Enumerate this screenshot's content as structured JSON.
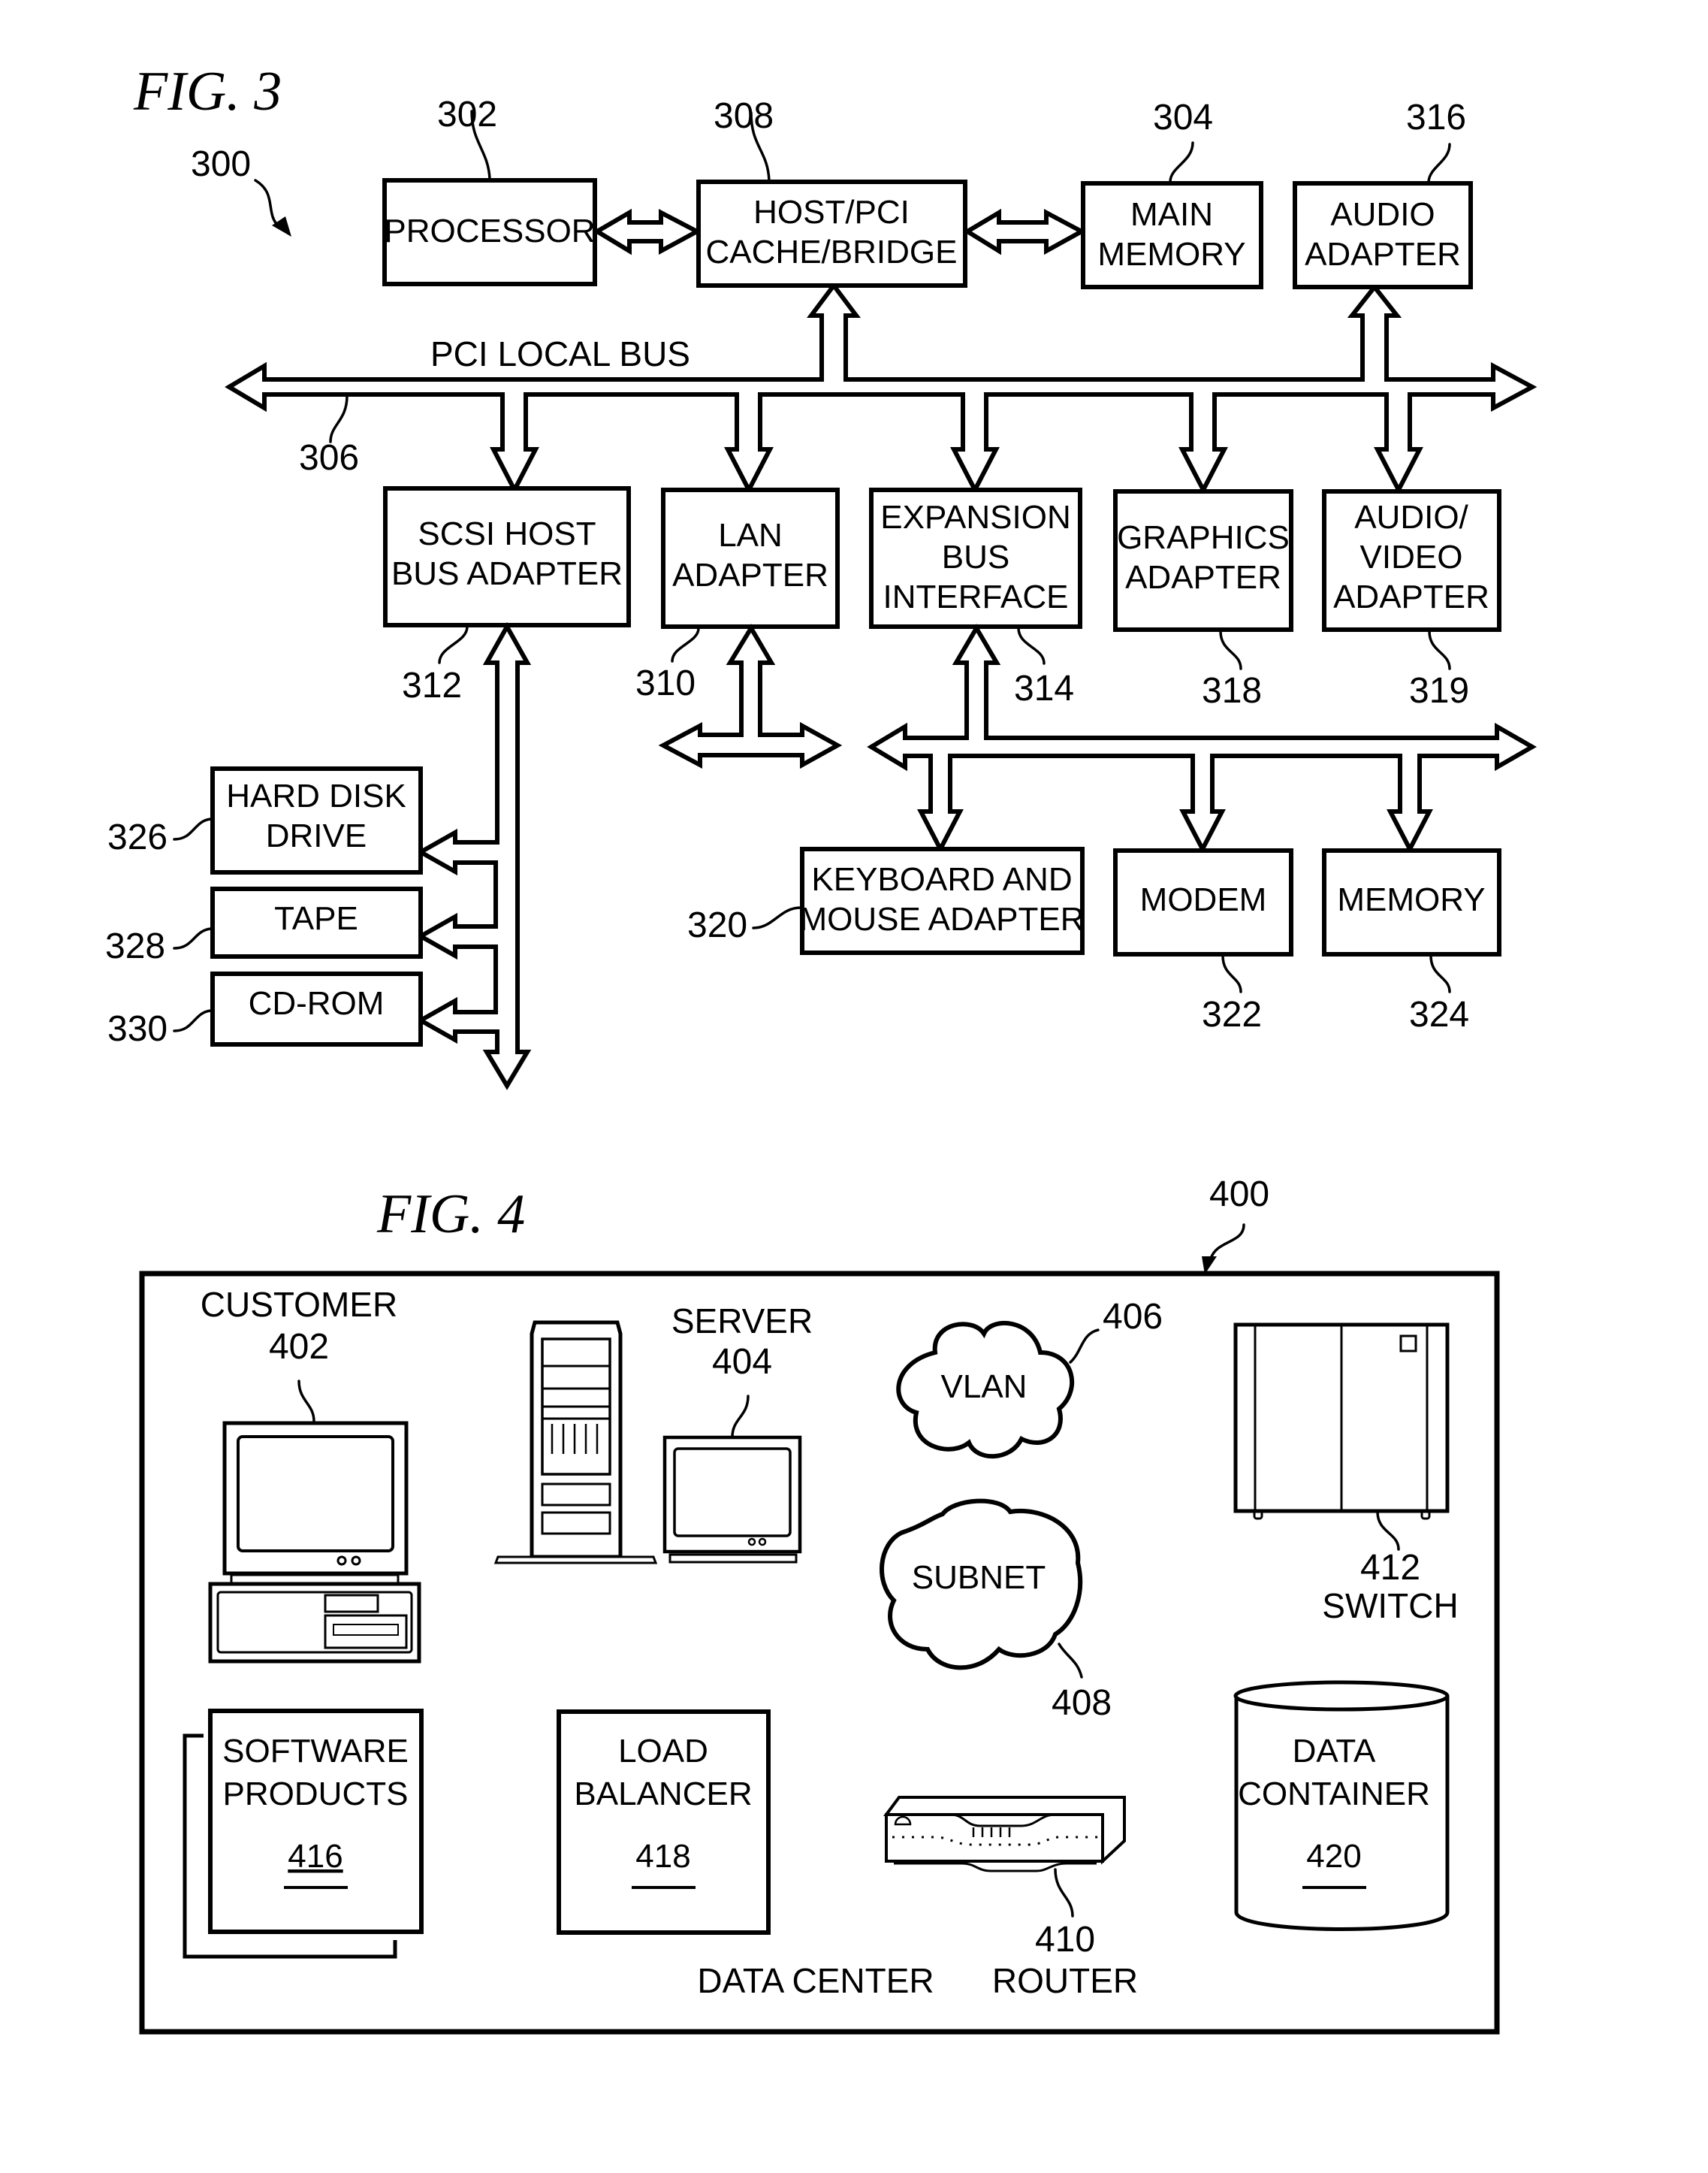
{
  "fig3": {
    "title": "FIG. 3",
    "ref_system": "300",
    "bus_label": "PCI LOCAL BUS",
    "bus_ref": "306",
    "blocks": {
      "processor": {
        "lines": [
          "PROCESSOR"
        ],
        "ref": "302"
      },
      "host_bridge": {
        "lines": [
          "HOST/PCI",
          "CACHE/BRIDGE"
        ],
        "ref": "308"
      },
      "main_memory": {
        "lines": [
          "MAIN",
          "MEMORY"
        ],
        "ref": "304"
      },
      "audio_adapter": {
        "lines": [
          "AUDIO",
          "ADAPTER"
        ],
        "ref": "316"
      },
      "scsi": {
        "lines": [
          "SCSI HOST",
          "BUS ADAPTER"
        ],
        "ref": "312"
      },
      "lan": {
        "lines": [
          "LAN",
          "ADAPTER"
        ],
        "ref": "310"
      },
      "expansion": {
        "lines": [
          "EXPANSION",
          "BUS",
          "INTERFACE"
        ],
        "ref": "314"
      },
      "graphics": {
        "lines": [
          "GRAPHICS",
          "ADAPTER"
        ],
        "ref": "318"
      },
      "av_adapter": {
        "lines": [
          "AUDIO/",
          "VIDEO",
          "ADAPTER"
        ],
        "ref": "319"
      },
      "hdd": {
        "lines": [
          "HARD DISK",
          "DRIVE"
        ],
        "ref": "326"
      },
      "tape": {
        "lines": [
          "TAPE"
        ],
        "ref": "328"
      },
      "cdrom": {
        "lines": [
          "CD-ROM"
        ],
        "ref": "330"
      },
      "keyboard": {
        "lines": [
          "KEYBOARD AND",
          "MOUSE ADAPTER"
        ],
        "ref": "320"
      },
      "modem": {
        "lines": [
          "MODEM"
        ],
        "ref": "322"
      },
      "memory": {
        "lines": [
          "MEMORY"
        ],
        "ref": "324"
      }
    }
  },
  "fig4": {
    "title": "FIG. 4",
    "ref_system": "400",
    "caption": "DATA CENTER",
    "customer": {
      "label": "CUSTOMER",
      "ref": "402"
    },
    "server": {
      "label": "SERVER",
      "ref": "404"
    },
    "vlan": {
      "label": "VLAN",
      "ref": "406"
    },
    "subnet": {
      "label": "SUBNET",
      "ref": "408"
    },
    "router": {
      "label": "ROUTER",
      "ref": "410"
    },
    "switch": {
      "label": "SWITCH",
      "ref": "412"
    },
    "software": {
      "lines": [
        "SOFTWARE",
        "PRODUCTS"
      ],
      "ref": "416"
    },
    "load_balancer": {
      "lines": [
        "LOAD",
        "BALANCER"
      ],
      "ref": "418"
    },
    "data_container": {
      "lines": [
        "DATA",
        "CONTAINER"
      ],
      "ref": "420"
    }
  }
}
